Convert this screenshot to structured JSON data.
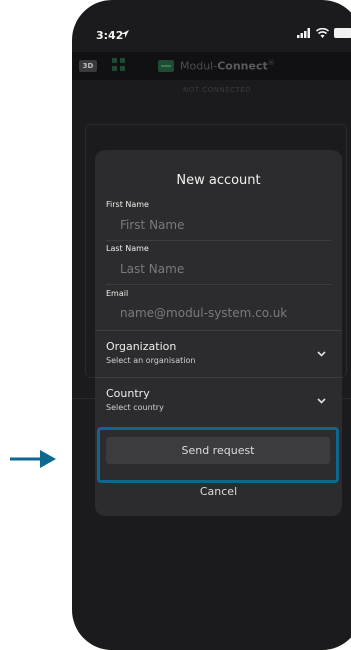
{
  "status_bar": {
    "time": "3:42"
  },
  "app_bar": {
    "badge": "3D",
    "brand_prefix": "Modul-",
    "brand_suffix": "Connect",
    "brand_mark": "®",
    "connection_status": "NOT CONNECTED"
  },
  "modal": {
    "title": "New account",
    "first_name": {
      "label": "First Name",
      "placeholder": "First Name"
    },
    "last_name": {
      "label": "Last Name",
      "placeholder": "Last Name"
    },
    "email": {
      "label": "Email",
      "placeholder": "name@modul-system.co.uk"
    },
    "organization": {
      "label": "Organization",
      "value": "Select an organisation"
    },
    "country": {
      "label": "Country",
      "value": "Select country"
    },
    "send_button": "Send request",
    "cancel_button": "Cancel"
  },
  "colors": {
    "highlight": "#0c6791",
    "arrow": "#0c6791",
    "modal_bg": "#2c2c2e",
    "screen_bg": "#1b1b1d"
  },
  "icons": [
    "location-arrow-icon",
    "signal-icon",
    "wifi-icon",
    "battery-icon",
    "grid-icon",
    "gear-icon",
    "chevron-down-icon",
    "right-arrow-icon"
  ]
}
